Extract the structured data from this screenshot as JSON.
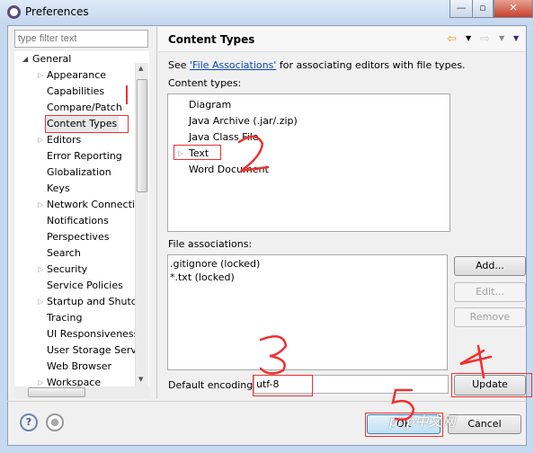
{
  "window": {
    "title": "Preferences",
    "controls": {
      "minimize": "—",
      "maximize": "▫",
      "close": "✕"
    }
  },
  "filter": {
    "placeholder": "type filter text"
  },
  "tree": {
    "root": "General",
    "items": [
      "Appearance",
      "Capabilities",
      "Compare/Patch",
      "Content Types",
      "Editors",
      "Error Reporting",
      "Globalization",
      "Keys",
      "Network Connectio",
      "Notifications",
      "Perspectives",
      "Search",
      "Security",
      "Service Policies",
      "Startup and Shutd",
      "Tracing",
      "UI Responsiveness",
      "User Storage Serv",
      "Web Browser",
      "Workspace"
    ],
    "expandable": [
      0,
      4,
      8,
      12,
      14,
      19
    ],
    "selected": 3
  },
  "page": {
    "title": "Content Types",
    "see_prefix": "See ",
    "see_link": "'File Associations'",
    "see_suffix": " for associating editors with file types.",
    "content_types_label": "Content types:",
    "content_types": [
      "Diagram",
      "Java Archive (.jar/.zip)",
      "Java Class File",
      "Text",
      "Word Document"
    ],
    "file_assoc_label": "File associations:",
    "file_assoc": [
      ".gitignore (locked)",
      "*.txt (locked)"
    ],
    "add": "Add...",
    "edit": "Edit...",
    "remove": "Remove",
    "encoding_label": "Default encoding:",
    "encoding_value": "utf-8",
    "update": "Update"
  },
  "footer": {
    "ok": "OK",
    "cancel": "Cancel"
  },
  "annotations": [
    "2",
    "3",
    "4",
    "5"
  ],
  "watermark": "php中文网",
  "colors": {
    "annotation": "#f03030",
    "link": "#0a47b5",
    "selection": "#e8e8e8"
  }
}
